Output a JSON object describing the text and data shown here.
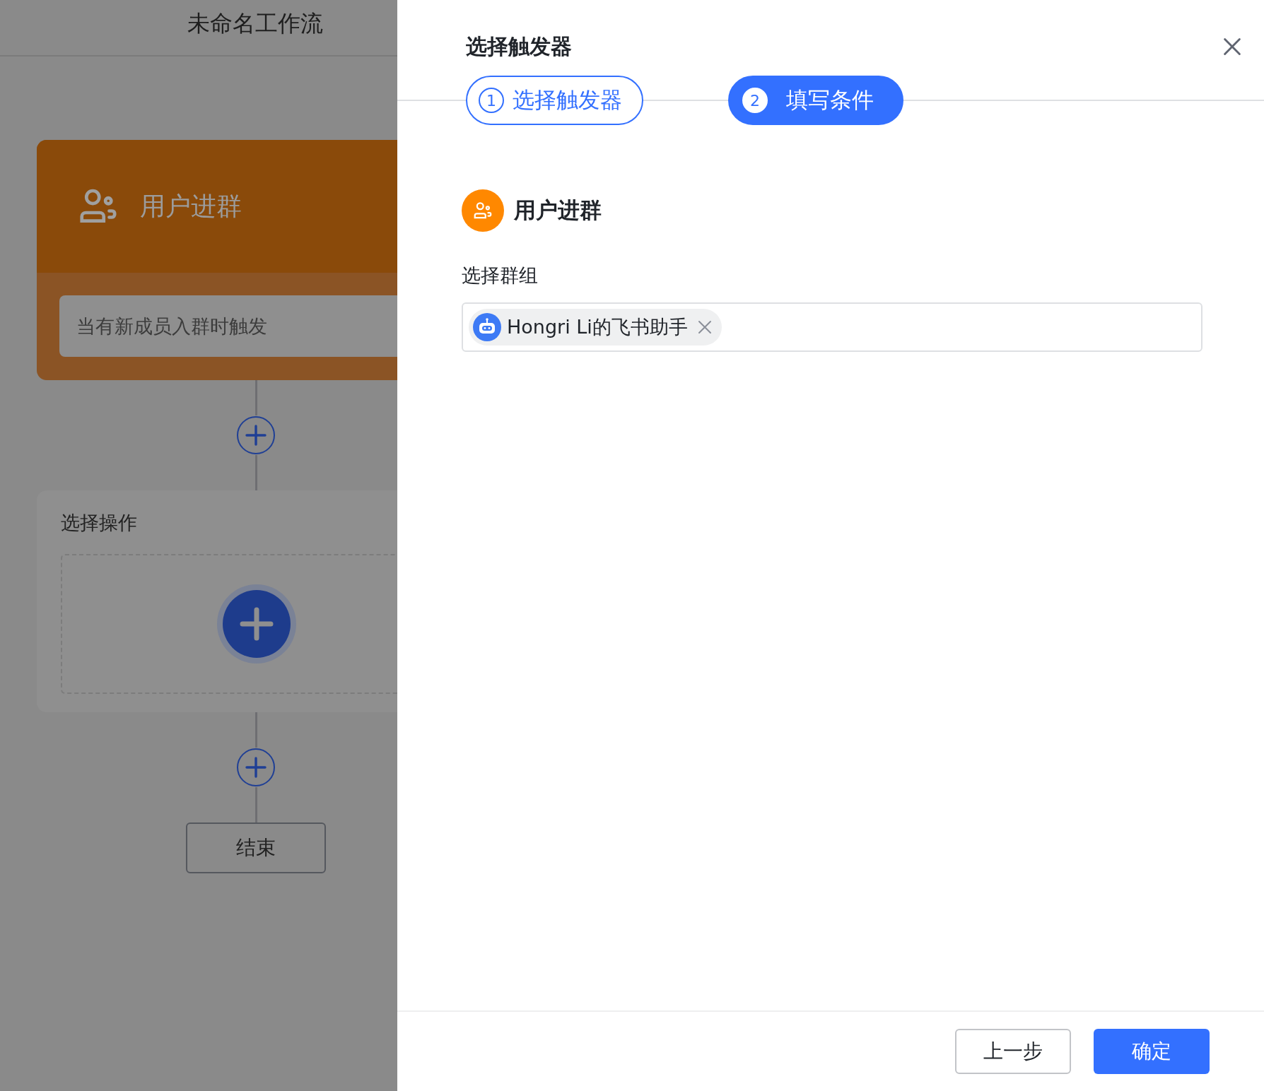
{
  "canvas": {
    "title": "未命名工作流",
    "trigger_node": {
      "title": "用户进群",
      "description": "当有新成员入群时触发"
    },
    "action_node": {
      "title": "选择操作"
    },
    "end_node": {
      "label": "结束"
    }
  },
  "drawer": {
    "title": "选择触发器",
    "steps": [
      {
        "number": "1",
        "label": "选择触发器",
        "selected": false
      },
      {
        "number": "2",
        "label": "填写条件",
        "selected": true
      }
    ],
    "section": {
      "title": "用户进群"
    },
    "field": {
      "label": "选择群组",
      "tags": [
        {
          "label": "Hongri Li的飞书助手"
        }
      ]
    },
    "buttons": [
      {
        "label": "上一步",
        "kind": "secondary"
      },
      {
        "label": "确定",
        "kind": "primary"
      }
    ]
  }
}
